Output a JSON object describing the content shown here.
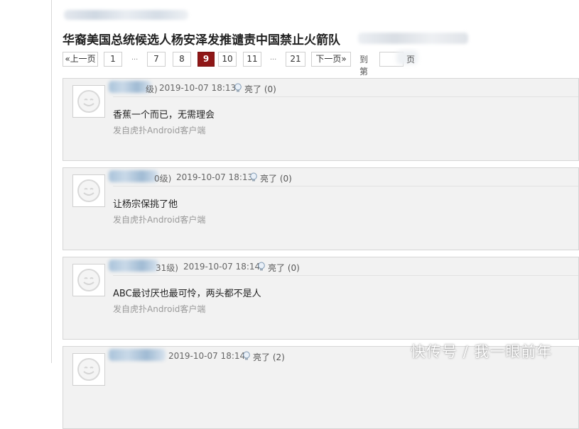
{
  "page": {
    "title": "华裔美国总统候选人杨安泽发推谴责中国禁止火箭队"
  },
  "pagination": {
    "prev_label": "«上一页",
    "next_label": "下一页»",
    "pages": [
      "1",
      "...",
      "7",
      "8",
      "9",
      "10",
      "11",
      "...",
      "21"
    ],
    "current": "9",
    "goto_label": "到第",
    "goto_suffix": "页",
    "goto_value": ""
  },
  "posts": [
    {
      "level_fragment": "级)",
      "timestamp": "2019-10-07 18:13",
      "like_label": "亮了 (0)",
      "content": "香蕉一个而已，无需理会",
      "source": "发自虎扑Android客户端"
    },
    {
      "level_fragment": "0级)",
      "timestamp": "2019-10-07 18:13",
      "like_label": "亮了 (0)",
      "content": "让杨宗保挑了他",
      "source": "发自虎扑Android客户端"
    },
    {
      "level_fragment": "31级)",
      "timestamp": "2019-10-07 18:14",
      "like_label": "亮了 (0)",
      "content": "ABC最讨厌也最可怜，两头都不是人",
      "source": "发自虎扑Android客户端"
    },
    {
      "level_fragment": "",
      "timestamp": "2019-10-07 18:14",
      "like_label": "亮了 (2)",
      "content": "",
      "source": ""
    }
  ],
  "watermark": "快传号 / 我一眼前年",
  "colors": {
    "current_page_bg": "#8f1717",
    "post_bg": "#f2f2f2"
  },
  "icons": {
    "avatar": "smiley-face-icon",
    "like": "lightbulb-icon"
  }
}
